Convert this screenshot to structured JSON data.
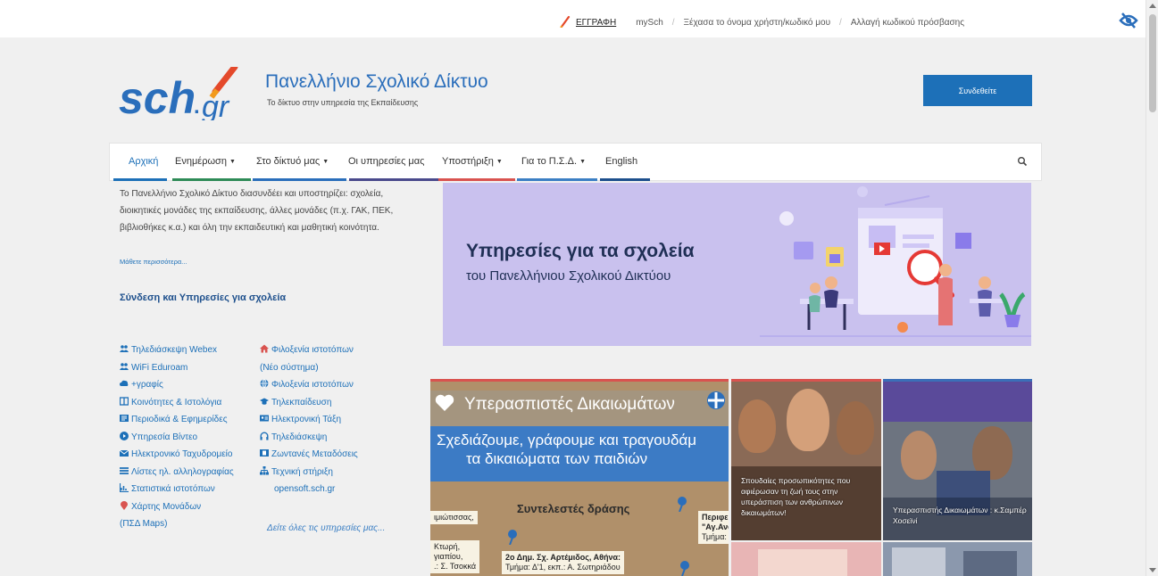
{
  "topbar": {
    "register": "ΕΓΓΡΑΦΗ",
    "mysch": "mySch",
    "forgot": "Ξέχασα το όνομα χρήστη/κωδικό μου",
    "change_password": "Αλλαγή κωδικού πρόσβασης",
    "separator": "/"
  },
  "header": {
    "logo_text": "sch.gr",
    "title": "Πανελλήνιο Σχολικό Δίκτυο",
    "subtitle": "Το δίκτυο στην υπηρεσία της Εκπαίδευσης",
    "login_label": "Συνδεθείτε"
  },
  "nav": {
    "items": [
      {
        "label": "Αρχική",
        "caret": ""
      },
      {
        "label": "Ενημέρωση",
        "caret": "▼"
      },
      {
        "label": "Στο δίκτυό μας",
        "caret": "▼"
      },
      {
        "label": "Οι υπηρεσίες μας",
        "caret": ""
      },
      {
        "label": "Υποστήριξη",
        "caret": "▼"
      },
      {
        "label": "Για το Π.Σ.Δ.",
        "caret": "▼"
      },
      {
        "label": "English",
        "caret": ""
      }
    ],
    "colors": [
      "#1d70b8",
      "#2e8b57",
      "#2a6ebb",
      "#4a4a8c",
      "#d9534f",
      "#3b7fc4",
      "#1d4f8c"
    ]
  },
  "intro": {
    "text": "Το Πανελλήνιο Σχολικό Δίκτυο διασυνδέει και υποστηρίζει: σχολεία, διοικητικές μονάδες της εκπαίδευσης, άλλες μονάδες (π.χ. ΓΑΚ, ΠΕΚ, βιβλιοθήκες κ.α.) και όλη την εκπαιδευτική και μαθητική κοινότητα.",
    "more": "Μάθετε περισσότερα..."
  },
  "services": {
    "heading": "Σύνδεση και Υπηρεσίες για σχολεία",
    "col1": [
      {
        "label": "Τηλεδιάσκεψη Webex",
        "icon": "users-icon"
      },
      {
        "label": "WiFi Eduroam",
        "icon": "users-icon"
      },
      {
        "label": "+γραφίς",
        "icon": "cloud-icon"
      },
      {
        "label": "Κοινότητες & Ιστολόγια",
        "icon": "columns-icon"
      },
      {
        "label": "Περιοδικά & Εφημερίδες",
        "icon": "newspaper-icon"
      },
      {
        "label": "Υπηρεσία Βίντεο",
        "icon": "play-icon"
      },
      {
        "label": "Ηλεκτρονικό Ταχυδρομείο",
        "icon": "envelope-icon"
      },
      {
        "label": "Λίστες ηλ. αλληλογραφίας",
        "icon": "list-icon"
      },
      {
        "label": "Στατιστικά ιστοτόπων",
        "icon": "chart-icon"
      },
      {
        "label": "Χάρτης Μονάδων",
        "icon": "map-marker-icon"
      }
    ],
    "col1_tail": "(ΠΣΔ Maps)",
    "col2": [
      {
        "label": "Φιλοξενία ιστοτόπων",
        "icon": "home-icon"
      },
      {
        "label": "Φιλοξενία ιστοτόπων",
        "icon": "globe-icon"
      },
      {
        "label": "Τηλεκπαίδευση",
        "icon": "graduation-cap-icon"
      },
      {
        "label": "Ηλεκτρονική Τάξη",
        "icon": "id-card-icon"
      },
      {
        "label": "Τηλεδιάσκεψη",
        "icon": "headphones-icon"
      },
      {
        "label": "Ζωντανές Μεταδόσεις",
        "icon": "film-icon"
      },
      {
        "label": "Τεχνική στήριξη",
        "icon": "sitemap-icon"
      },
      {
        "label": "opensoft.sch.gr",
        "icon": ""
      }
    ],
    "col2_after_first": "(Νέο σύστημα)",
    "all": "Δείτε όλες τις υπηρεσίες μας..."
  },
  "hero": {
    "title": "Υπηρεσίες για τα σχολεία",
    "subtitle": "του Πανελλήνιου Σχολικού Δικτύου"
  },
  "tiles": {
    "t1": {
      "band": "Υπερασπιστές Δικαιωμάτων",
      "line1": "Σχεδιάζουμε, γράφουμε και τραγουδάμ",
      "line2": "τα δικαιώματα των παιδιών",
      "sub": "Συντελεστές δράσης",
      "c1": "ιμιώτισσας,",
      "c2": "Περιφε",
      "c2b": "\"Αγ.Αναρ",
      "c2c": "Τμήμα: Β',",
      "c3": "2ο Δημ. Σχ. Αρτέμιδος, Αθήνα:",
      "c3b": "Τμήμα: Δ'1, εκπ.: Α. Σωτηριάδου",
      "c4": "Κτωρή,",
      "c4b": "γιαπίου,",
      "c4c": ".: Σ. Τσοκκά"
    },
    "t2_caption": "Σπουδαίες προσωπικότητες που αφιέρωσαν τη ζωή τους στην υπεράσπιση των ανθρώπινων δικαιωμάτων!",
    "t3_caption": "Υπερασπιστής Δικαιωμάτων : κ.Σαμπέρ Χοσεϊνί"
  }
}
